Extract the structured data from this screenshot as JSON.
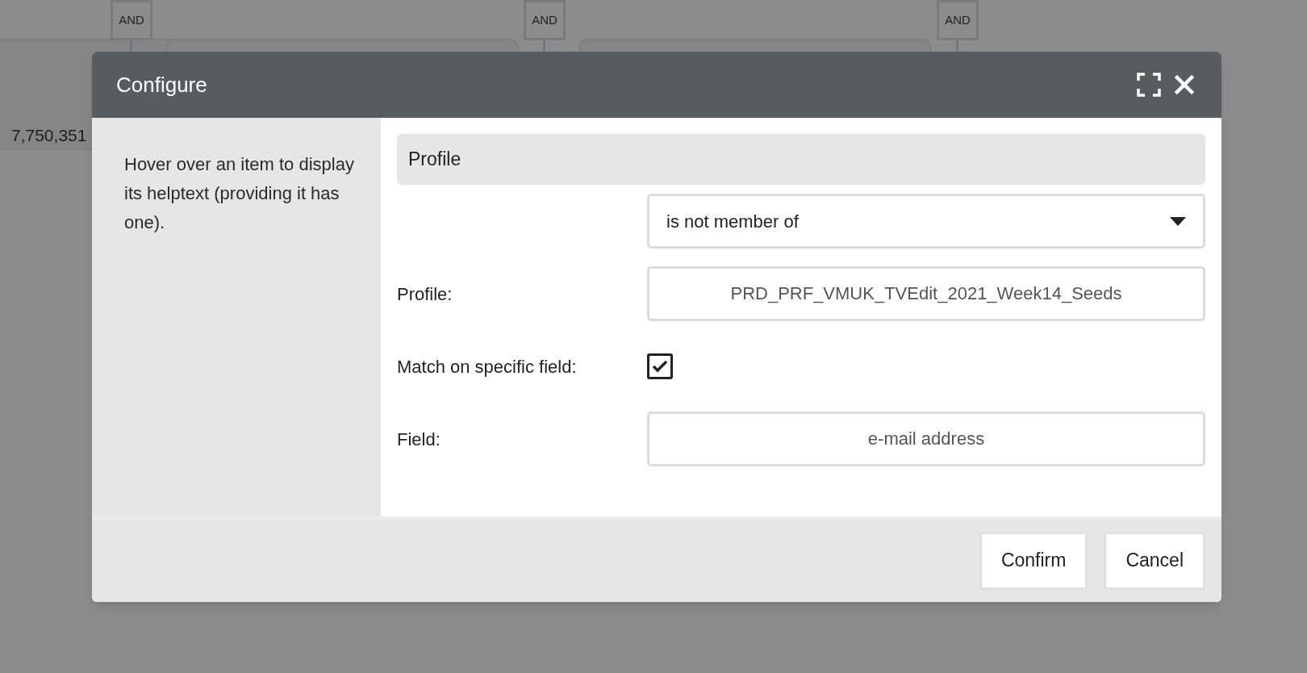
{
  "canvas": {
    "operators": [
      "AND",
      "AND",
      "AND"
    ],
    "counts": [
      "7,750,351"
    ]
  },
  "dialog": {
    "title": "Configure",
    "help_text": "Hover over an item to display its helptext (providing it has one).",
    "section_title": "Profile",
    "operator_select": {
      "value": "is not member of"
    },
    "fields": [
      {
        "kind": "text",
        "label": "Profile:",
        "value": "PRD_PRF_VMUK_TVEdit_2021_Week14_Seeds"
      },
      {
        "kind": "checkbox",
        "label": "Match on specific field:",
        "checked": true
      },
      {
        "kind": "text",
        "label": "Field:",
        "value": "e-mail address"
      }
    ],
    "buttons": [
      "Confirm",
      "Cancel"
    ]
  }
}
